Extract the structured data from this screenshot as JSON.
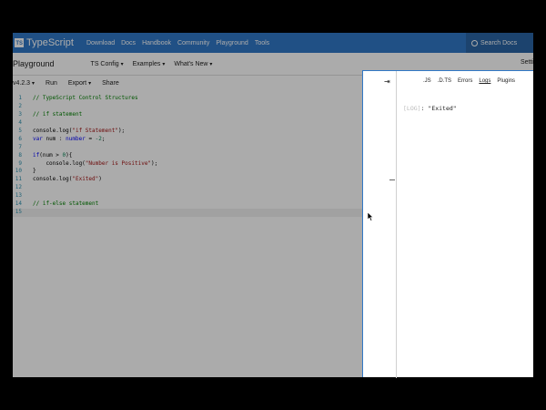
{
  "nav": {
    "logo_text": "TS",
    "brand": "TypeScript",
    "links": [
      "Download",
      "Docs",
      "Handbook",
      "Community",
      "Playground",
      "Tools"
    ],
    "search": "Search Docs"
  },
  "subnav": {
    "title": "Playground",
    "items": [
      "TS Config",
      "Examples",
      "What's New"
    ],
    "settings": "Setti"
  },
  "toolbar": {
    "version": "v4.2.3",
    "run": "Run",
    "export": "Export",
    "share": "Share"
  },
  "editor": {
    "lines": [
      {
        "n": "1",
        "tokens": [
          {
            "t": "// TypeScript Control Structures",
            "c": "comment"
          }
        ]
      },
      {
        "n": "2",
        "tokens": []
      },
      {
        "n": "3",
        "tokens": [
          {
            "t": "// if statement",
            "c": "comment"
          }
        ]
      },
      {
        "n": "4",
        "tokens": []
      },
      {
        "n": "5",
        "tokens": [
          {
            "t": "console.log(",
            "c": "plain"
          },
          {
            "t": "\"if Statement\"",
            "c": "str"
          },
          {
            "t": ");",
            "c": "plain"
          }
        ]
      },
      {
        "n": "6",
        "tokens": [
          {
            "t": "var",
            "c": "kw"
          },
          {
            "t": " num : ",
            "c": "plain"
          },
          {
            "t": "number",
            "c": "kw"
          },
          {
            "t": " = ",
            "c": "plain"
          },
          {
            "t": "-2",
            "c": "num"
          },
          {
            "t": ";",
            "c": "plain"
          }
        ]
      },
      {
        "n": "7",
        "tokens": []
      },
      {
        "n": "8",
        "tokens": [
          {
            "t": "if",
            "c": "kw"
          },
          {
            "t": "(num > ",
            "c": "plain"
          },
          {
            "t": "0",
            "c": "num"
          },
          {
            "t": "){",
            "c": "plain"
          }
        ]
      },
      {
        "n": "9",
        "tokens": [
          {
            "t": "    console.log(",
            "c": "plain"
          },
          {
            "t": "\"Number is Positive\"",
            "c": "str"
          },
          {
            "t": ");",
            "c": "plain"
          }
        ]
      },
      {
        "n": "10",
        "tokens": [
          {
            "t": "}",
            "c": "plain"
          }
        ]
      },
      {
        "n": "11",
        "tokens": [
          {
            "t": "console.log(",
            "c": "plain"
          },
          {
            "t": "\"Exited\"",
            "c": "str"
          },
          {
            "t": ")",
            "c": "plain"
          }
        ]
      },
      {
        "n": "12",
        "tokens": []
      },
      {
        "n": "13",
        "tokens": []
      },
      {
        "n": "14",
        "tokens": [
          {
            "t": "// if-else statement",
            "c": "comment"
          }
        ]
      },
      {
        "n": "15",
        "tokens": []
      }
    ]
  },
  "panel": {
    "collapse_icon": "collapse-arrow-icon",
    "tabs": [
      ".JS",
      ".D.TS",
      "Errors",
      "Logs",
      "Plugins"
    ],
    "active_tab": "Logs",
    "log_tag": "[LOG]",
    "log_text": ": \"Exited\""
  }
}
